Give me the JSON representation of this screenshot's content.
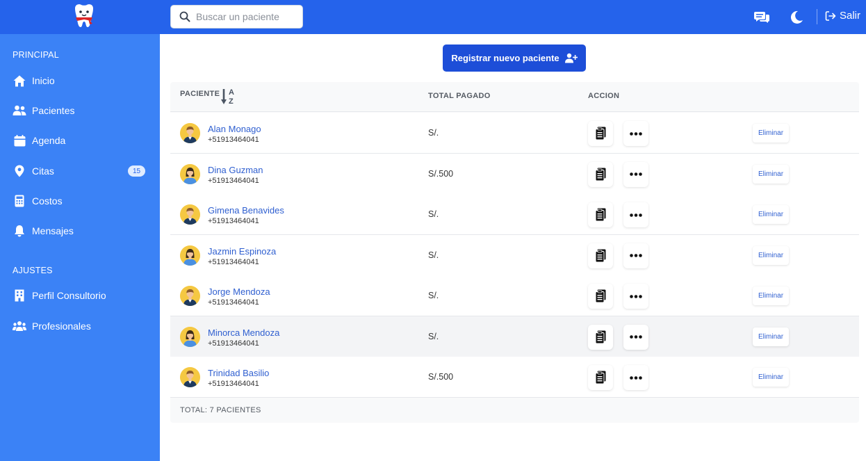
{
  "topbar": {
    "search_placeholder": "Buscar un paciente",
    "logout_label": "Salir"
  },
  "sidebar": {
    "section_principal": "PRINCIPAL",
    "section_ajustes": "AJUSTES",
    "items": [
      {
        "label": "Inicio",
        "icon": "home-icon"
      },
      {
        "label": "Pacientes",
        "icon": "users-icon"
      },
      {
        "label": "Agenda",
        "icon": "calendar-icon"
      },
      {
        "label": "Citas",
        "icon": "location-pin-icon",
        "badge": "15"
      },
      {
        "label": "Costos",
        "icon": "calculator-icon"
      },
      {
        "label": "Mensajes",
        "icon": "bell-icon"
      },
      {
        "label": "Perfil Consultorio",
        "icon": "building-icon"
      },
      {
        "label": "Profesionales",
        "icon": "group-icon"
      }
    ]
  },
  "main": {
    "register_label": "Registrar nuevo paciente"
  },
  "table": {
    "headers": {
      "patient": "PACIENTE",
      "sort_a": "A",
      "sort_z": "Z",
      "paid": "TOTAL PAGADO",
      "action": "ACCION"
    },
    "delete_label": "Eliminar",
    "rows": [
      {
        "name": "Alan Monago",
        "phone": "+51913464041",
        "paid": "S/.",
        "gender": "m"
      },
      {
        "name": "Dina Guzman",
        "phone": "+51913464041",
        "paid": "S/.500",
        "gender": "f"
      },
      {
        "name": "Gimena Benavides",
        "phone": "+51913464041",
        "paid": "S/.",
        "gender": "m"
      },
      {
        "name": "Jazmin Espinoza",
        "phone": "+51913464041",
        "paid": "S/.",
        "gender": "f"
      },
      {
        "name": "Jorge Mendoza",
        "phone": "+51913464041",
        "paid": "S/.",
        "gender": "m"
      },
      {
        "name": "Minorca Mendoza",
        "phone": "+51913464041",
        "paid": "S/.",
        "gender": "f"
      },
      {
        "name": "Trinidad Basilio",
        "phone": "+51913464041",
        "paid": "S/.500",
        "gender": "m"
      }
    ],
    "total": "TOTAL: 7 PACIENTES"
  },
  "colors": {
    "topbar": "#2563eb",
    "sidebar": "#3b82f6",
    "primary_button": "#1d4ed8",
    "link": "#2f5fd0"
  }
}
